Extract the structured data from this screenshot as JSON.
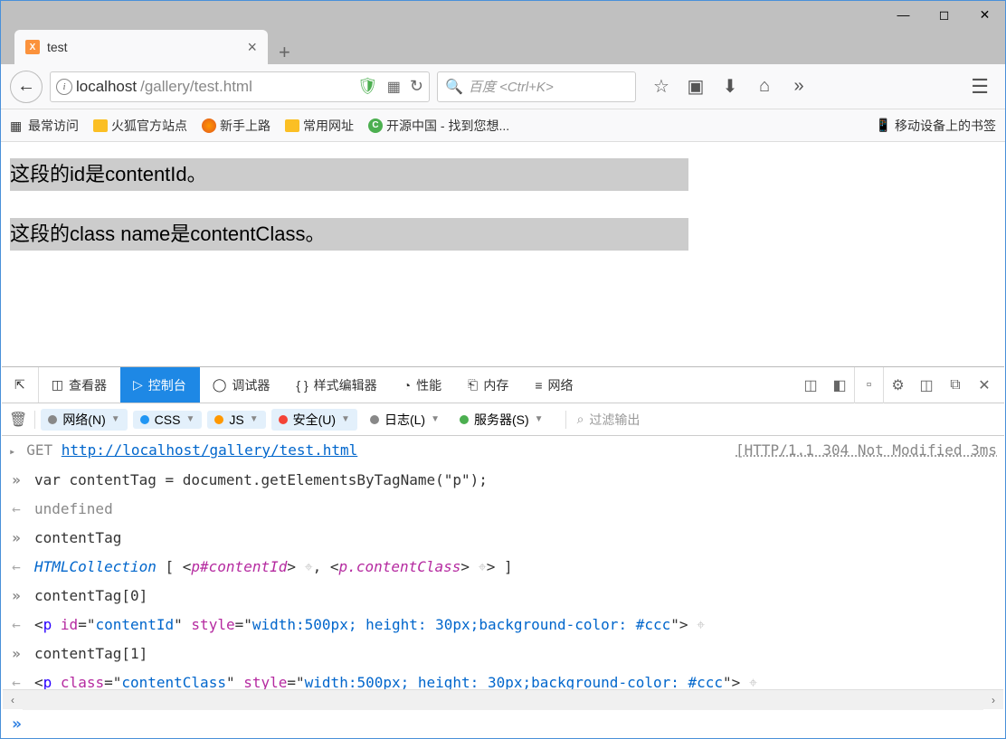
{
  "window": {
    "title": "test"
  },
  "tab": {
    "title": "test"
  },
  "address": {
    "host": "localhost",
    "path": "/gallery/test.html"
  },
  "search": {
    "placeholder": "百度 <Ctrl+K>"
  },
  "bookmarks": {
    "most_visited": "最常访问",
    "ff_official": "火狐官方站点",
    "getting_started": "新手上路",
    "common": "常用网址",
    "oschina": "开源中国 - 找到您想...",
    "mobile": "移动设备上的书签"
  },
  "page": {
    "p1": "这段的id是contentId。",
    "p2": "这段的class name是contentClass。"
  },
  "devtools": {
    "tabs": {
      "inspector": "查看器",
      "console": "控制台",
      "debugger": "调试器",
      "style": "样式编辑器",
      "performance": "性能",
      "memory": "内存",
      "network": "网络"
    },
    "filters": {
      "net": "网络(N)",
      "css": "CSS",
      "js": "JS",
      "security": "安全(U)",
      "log": "日志(L)",
      "server": "服务器(S)",
      "filter_ph": "过滤输出"
    },
    "console_lines": {
      "l0_method": "GET",
      "l0_url": "http://localhost/gallery/test.html",
      "l0_status": "[HTTP/1.1 304 Not Modified 3ms",
      "l1": "var contentTag = document.getElementsByTagName(\"p\");",
      "l2": "undefined",
      "l3": "contentTag",
      "l4_pre": "HTMLCollection",
      "l4_open": " [ <",
      "l4_sel1": "p#contentId",
      "l4_mid": "> ",
      "l4_comma": ", <",
      "l4_sel2": "p.contentClass",
      "l4_end": ">  ]",
      "l5": "contentTag[0]",
      "l6_open": "<",
      "l6_tag": "p",
      "l6_sp1": " ",
      "l6_a1": "id",
      "l6_eq": "=\"",
      "l6_v1": "contentId",
      "l6_q": "\" ",
      "l6_a2": "style",
      "l6_v2": "width:500px; height: 30px;background-color: #ccc",
      "l6_close": "\">",
      "l7": "contentTag[1]",
      "l8_a1": "class",
      "l8_v1": "contentClass"
    }
  }
}
